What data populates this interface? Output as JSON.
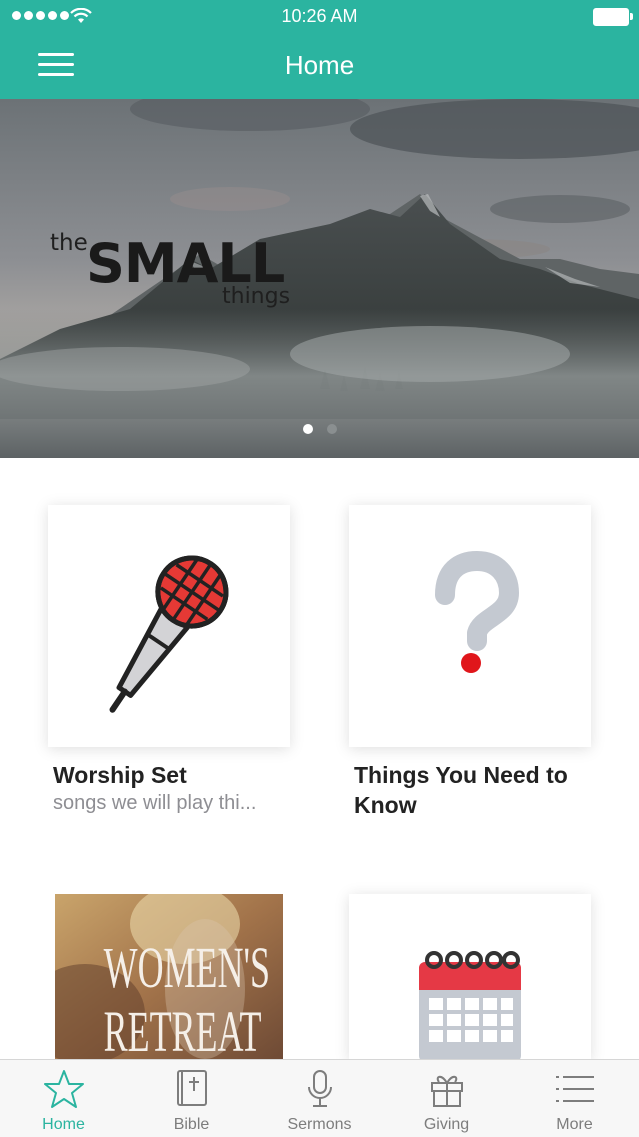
{
  "status": {
    "time": "10:26 AM"
  },
  "nav": {
    "title": "Home"
  },
  "hero": {
    "logo_the": "the",
    "logo_small": "SMALL",
    "logo_things": "things",
    "pages": 2,
    "active_page": 1
  },
  "cards": [
    {
      "title": "Worship Set",
      "subtitle": "songs we will play thi...",
      "icon": "microphone-icon"
    },
    {
      "title": "Things You Need to Know",
      "subtitle": "",
      "icon": "question-mark-icon"
    },
    {
      "title": "",
      "subtitle": "",
      "image_text": "WOMEN'S RETREAT",
      "image_line1": "WOMEN'S",
      "image_line2": "RETREAT"
    },
    {
      "title": "",
      "subtitle": "",
      "icon": "calendar-icon"
    }
  ],
  "tabs": [
    {
      "label": "Home",
      "icon": "star-icon",
      "active": true
    },
    {
      "label": "Bible",
      "icon": "bible-icon",
      "active": false
    },
    {
      "label": "Sermons",
      "icon": "microphone-icon",
      "active": false
    },
    {
      "label": "Giving",
      "icon": "gift-icon",
      "active": false
    },
    {
      "label": "More",
      "icon": "list-icon",
      "active": false
    }
  ],
  "colors": {
    "accent": "#2bb4a0",
    "tab_inactive": "#7d7d7d",
    "title_text": "#222222",
    "subtitle_text": "#8e8e93",
    "mic_red": "#e53935"
  }
}
